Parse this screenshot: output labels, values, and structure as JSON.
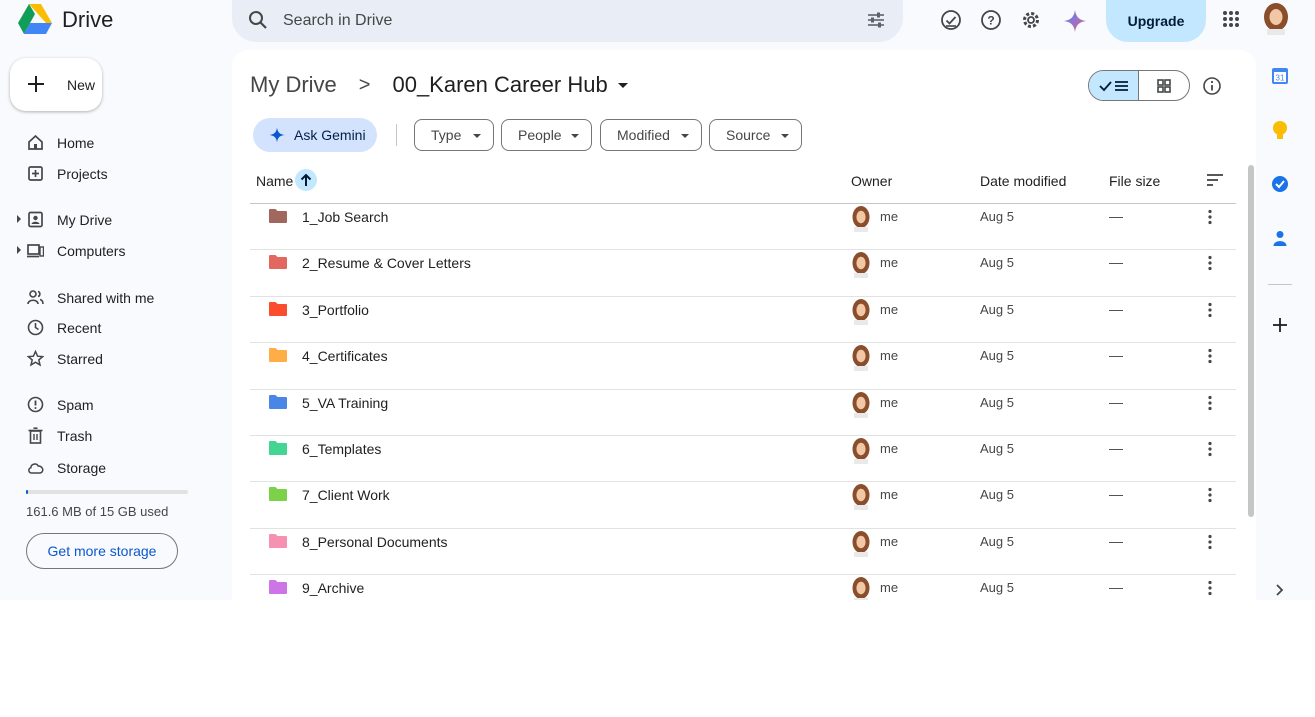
{
  "header": {
    "app_name": "Drive",
    "search_placeholder": "Search in Drive",
    "upgrade_label": "Upgrade"
  },
  "sidebar": {
    "new_label": "New",
    "items": [
      {
        "label": "Home",
        "icon": "home-icon"
      },
      {
        "label": "Projects",
        "icon": "projects-icon"
      },
      {
        "label": "My Drive",
        "icon": "my-drive-icon"
      },
      {
        "label": "Computers",
        "icon": "computers-icon"
      },
      {
        "label": "Shared with me",
        "icon": "shared-icon"
      },
      {
        "label": "Recent",
        "icon": "clock-icon"
      },
      {
        "label": "Starred",
        "icon": "star-icon"
      },
      {
        "label": "Spam",
        "icon": "spam-icon"
      },
      {
        "label": "Trash",
        "icon": "trash-icon"
      },
      {
        "label": "Storage",
        "icon": "cloud-icon"
      }
    ],
    "storage_text": "161.6 MB of 15 GB used",
    "storage_fraction": 0.011,
    "get_storage_label": "Get more storage"
  },
  "main": {
    "breadcrumb_root": "My Drive",
    "breadcrumb_sep": ">",
    "current_folder": "00_Karen Career Hub",
    "ask_gemini_label": "Ask Gemini",
    "filters": [
      "Type",
      "People",
      "Modified",
      "Source"
    ],
    "columns": {
      "name": "Name",
      "owner": "Owner",
      "modified": "Date modified",
      "size": "File size"
    },
    "rows": [
      {
        "name": "1_Job Search",
        "owner": "me",
        "modified": "Aug 5",
        "size": "—",
        "color": "#a1665e"
      },
      {
        "name": "2_Resume & Cover Letters",
        "owner": "me",
        "modified": "Aug 5",
        "size": "—",
        "color": "#e2685f"
      },
      {
        "name": "3_Portfolio",
        "owner": "me",
        "modified": "Aug 5",
        "size": "—",
        "color": "#fb4c2f"
      },
      {
        "name": "4_Certificates",
        "owner": "me",
        "modified": "Aug 5",
        "size": "—",
        "color": "#ffad47"
      },
      {
        "name": "5_VA Training",
        "owner": "me",
        "modified": "Aug 5",
        "size": "—",
        "color": "#4986e7"
      },
      {
        "name": "6_Templates",
        "owner": "me",
        "modified": "Aug 5",
        "size": "—",
        "color": "#42d692"
      },
      {
        "name": "7_Client Work",
        "owner": "me",
        "modified": "Aug 5",
        "size": "—",
        "color": "#7bd148"
      },
      {
        "name": "8_Personal Documents",
        "owner": "me",
        "modified": "Aug 5",
        "size": "—",
        "color": "#f691b2"
      },
      {
        "name": "9_Archive",
        "owner": "me",
        "modified": "Aug 5",
        "size": "—",
        "color": "#cd74e6"
      }
    ]
  },
  "rail": {
    "calendar_day": "31"
  },
  "colors": {
    "accent": "#0b57d0",
    "selected_bg": "#c2e7ff",
    "search_bg": "#e9eef6",
    "app_bg": "#f8fafd"
  }
}
